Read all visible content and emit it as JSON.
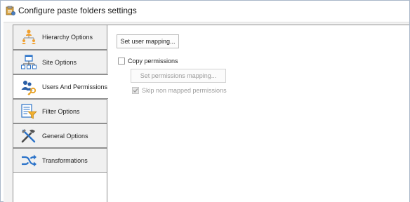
{
  "window": {
    "title": "Configure paste folders settings",
    "icon": "settings-window-icon"
  },
  "tabs": [
    {
      "label": "Hierarchy Options",
      "icon": "hierarchy-icon",
      "active": false
    },
    {
      "label": "Site Options",
      "icon": "site-icon",
      "active": false
    },
    {
      "label": "Users And Permissions",
      "icon": "users-key-icon",
      "active": true
    },
    {
      "label": "Filter Options",
      "icon": "filter-icon",
      "active": false
    },
    {
      "label": "General Options",
      "icon": "tools-icon",
      "active": false
    },
    {
      "label": "Transformations",
      "icon": "shuffle-icon",
      "active": false
    }
  ],
  "users_and_permissions": {
    "set_user_mapping_label": "Set user mapping...",
    "copy_permissions_label": "Copy permissions",
    "copy_permissions_checked": false,
    "set_permissions_mapping_label": "Set permissions mapping...",
    "skip_non_mapped_label": "Skip non mapped permissions",
    "skip_non_mapped_checked": true,
    "skip_non_mapped_enabled": false
  },
  "colors": {
    "accent_blue": "#2b73c9",
    "accent_orange": "#f0a030",
    "border": "#8f8f8f"
  }
}
